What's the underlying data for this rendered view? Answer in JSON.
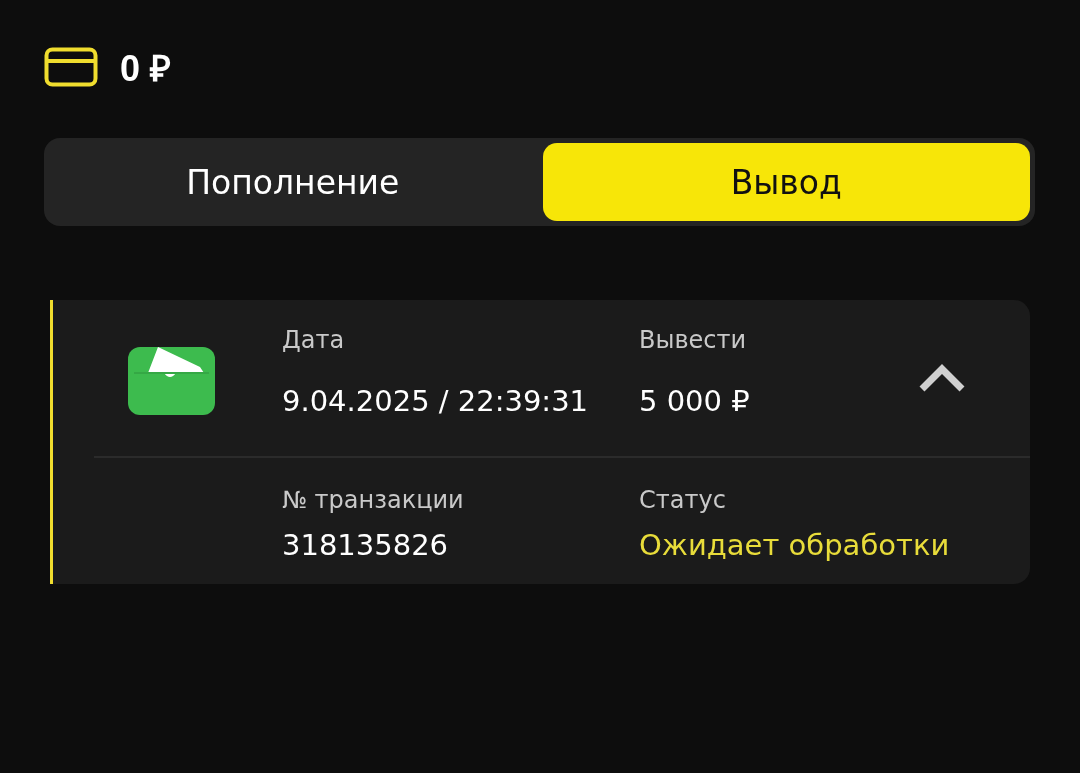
{
  "balance": "0 ₽",
  "tabs": [
    {
      "label": "Пополнение",
      "selected": false
    },
    {
      "label": "Вывод",
      "selected": true
    }
  ],
  "transactions": [
    {
      "expanded": true,
      "date_label": "Дата",
      "date": "9.04.2025 / 22:39:31",
      "amount_label": "Вывести",
      "amount": "5 000 ₽",
      "id_label": "№ транзакции",
      "id": "318135826",
      "status_label": "Статус",
      "status": "Ожидает обработки",
      "color": "#e8dc3a"
    }
  ]
}
